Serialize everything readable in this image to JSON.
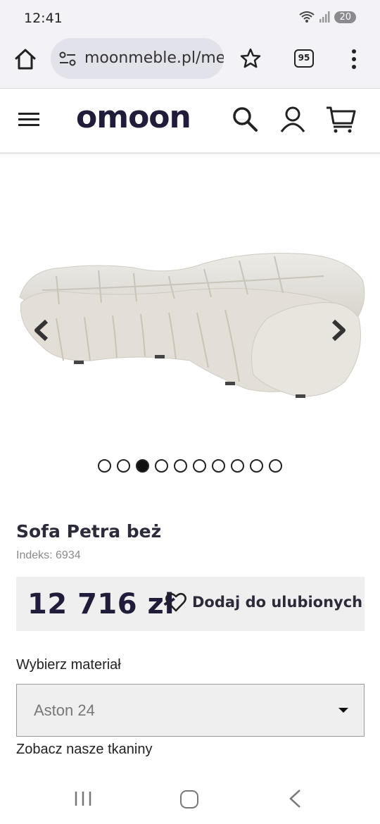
{
  "status_bar": {
    "time": "12:41",
    "battery": "20"
  },
  "browser": {
    "url": "moonmeble.pl/me",
    "tab_count": "95"
  },
  "header": {
    "logo": "omoon"
  },
  "gallery": {
    "dot_count": 10,
    "active_index": 2
  },
  "product": {
    "title": "Sofa Petra beż",
    "index": "Indeks: 6934",
    "price": "12 716 zł",
    "favorite_label": "Dodaj do ulubionych",
    "material_label": "Wybierz materiał",
    "material_value": "Aston 24",
    "fabrics_link": "Zobacz nasze tkaniny"
  },
  "colors": {
    "brand": "#1f1d3a",
    "sofa": "#e4e1da",
    "price_box": "#efefef"
  }
}
